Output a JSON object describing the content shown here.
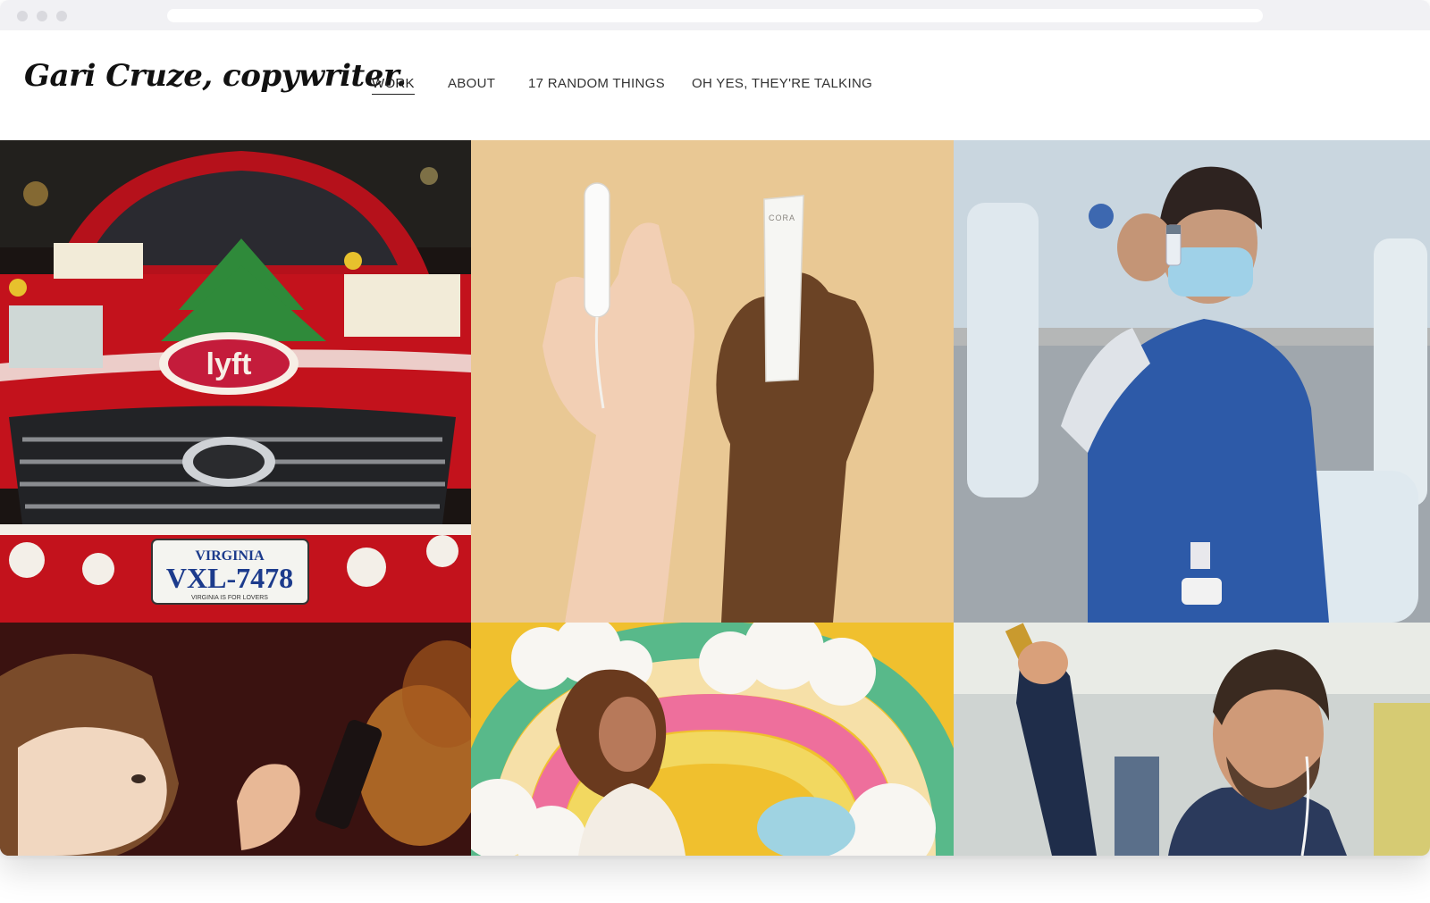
{
  "site": {
    "logo": "Gari Cruze, copywriter."
  },
  "nav": {
    "items": [
      {
        "label": "WORK",
        "active": true
      },
      {
        "label": "ABOUT",
        "active": false
      },
      {
        "label": "17 RANDOM THINGS",
        "active": false
      },
      {
        "label": "OH YES, THEY'RE TALKING",
        "active": false
      }
    ]
  },
  "portfolio": {
    "tiles": [
      {
        "name": "lyft-car-tile",
        "logo_text": "lyft",
        "plate_state": "VIRGINIA",
        "plate_number": "VXL-7478",
        "plate_tag": "VIRGINIA IS FOR LOVERS"
      },
      {
        "name": "cora-tampon-tile",
        "wrapper_text": "CORA"
      },
      {
        "name": "nurse-vaccine-tile"
      },
      {
        "name": "child-phone-tile"
      },
      {
        "name": "rainbow-woman-tile"
      },
      {
        "name": "subway-man-tile"
      }
    ]
  },
  "colors": {
    "lyft_red": "#c3121c",
    "tampon_bg": "#e9c894",
    "scrubs_blue": "#2d5aa8",
    "nav_text": "#333333"
  }
}
